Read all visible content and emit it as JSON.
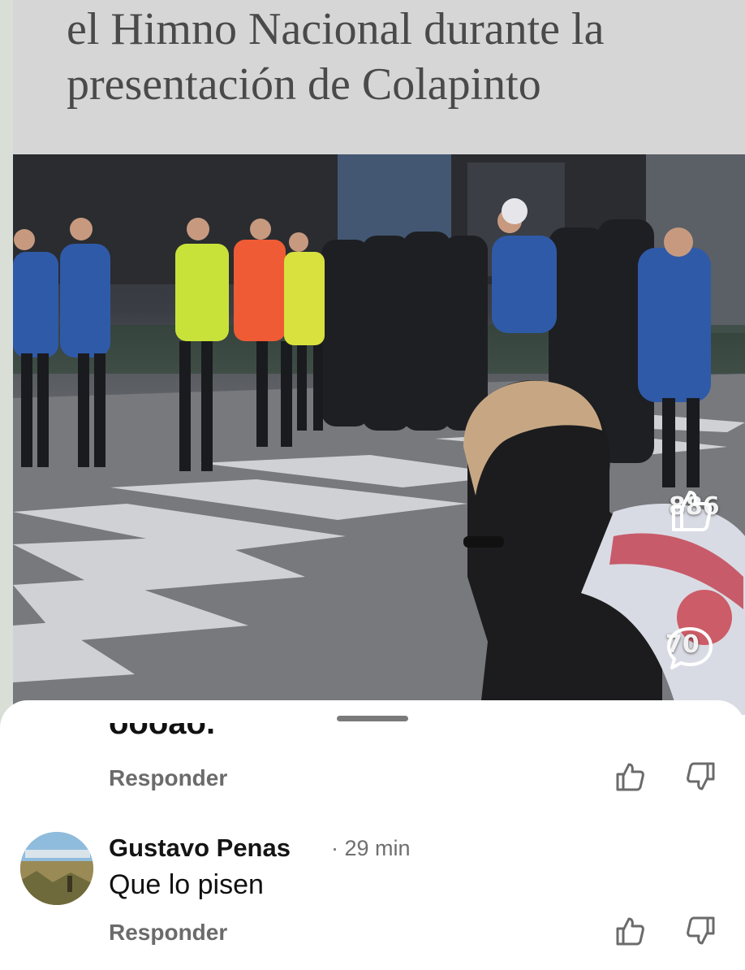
{
  "headline": {
    "line1": "el Himno Nacional durante la",
    "line2": "presentación de Colapinto"
  },
  "video": {
    "like_count": "886",
    "comment_count": "70",
    "like_icon": "thumbs-up-icon",
    "comment_icon": "speech-bubble-icon"
  },
  "sheet": {
    "prev_comment_tail": "oooao.",
    "reply_label_1": "Responder",
    "comment": {
      "author": "Gustavo Penas",
      "separator": "·",
      "time": "29 min",
      "text": "Que lo pisen",
      "reply_label": "Responder"
    }
  },
  "colors": {
    "headline_bg": "#d6d6d6",
    "reply_gray": "#6b6b6b",
    "text_dark": "#111111"
  }
}
